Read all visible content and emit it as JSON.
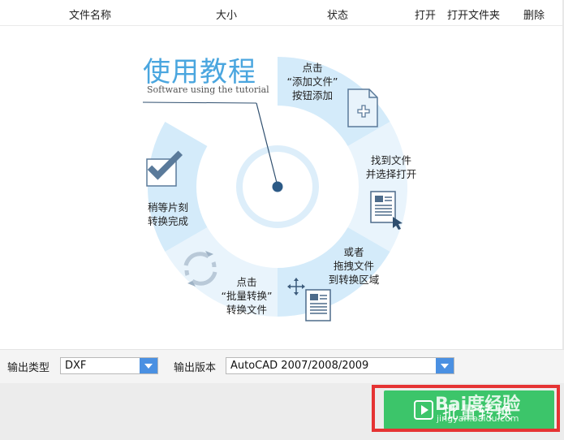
{
  "header": {
    "col_name": "文件名称",
    "col_size": "大小",
    "col_status": "状态",
    "open": "打开",
    "open_folder": "打开文件夹",
    "delete": "删除"
  },
  "tutorial": {
    "title_cn": "使用教程",
    "title_en": "Software using the tutorial",
    "steps": [
      {
        "lines": [
          "点击",
          "“添加文件”",
          "按钮添加"
        ],
        "icon": "add-file-icon"
      },
      {
        "lines": [
          "找到文件",
          "并选择打开"
        ],
        "icon": "document-cursor-icon"
      },
      {
        "lines": [
          "或者",
          "拖拽文件",
          "到转换区域"
        ],
        "icon": "drag-move-icon"
      },
      {
        "lines": [
          "点击",
          "“批量转换”",
          "转换文件"
        ],
        "icon": "refresh-cycle-icon"
      },
      {
        "lines": [
          "稍等片刻",
          "转换完成"
        ],
        "icon": "checkbox-check-icon"
      }
    ]
  },
  "options": {
    "output_type_label": "输出类型",
    "output_type_value": "DXF",
    "output_version_label": "输出版本",
    "output_version_value": "AutoCAD 2007/2008/2009"
  },
  "actions": {
    "convert_label": "批量转换"
  },
  "watermark": {
    "logo": "Bai度经验",
    "url": "jingyan.baidu.com"
  },
  "colors": {
    "accent_blue": "#4aa6df",
    "ring_light": "#d4ebfa",
    "ring_lighter": "#e9f4fc",
    "button_green": "#3cc56a",
    "highlight_red": "#e53333"
  }
}
